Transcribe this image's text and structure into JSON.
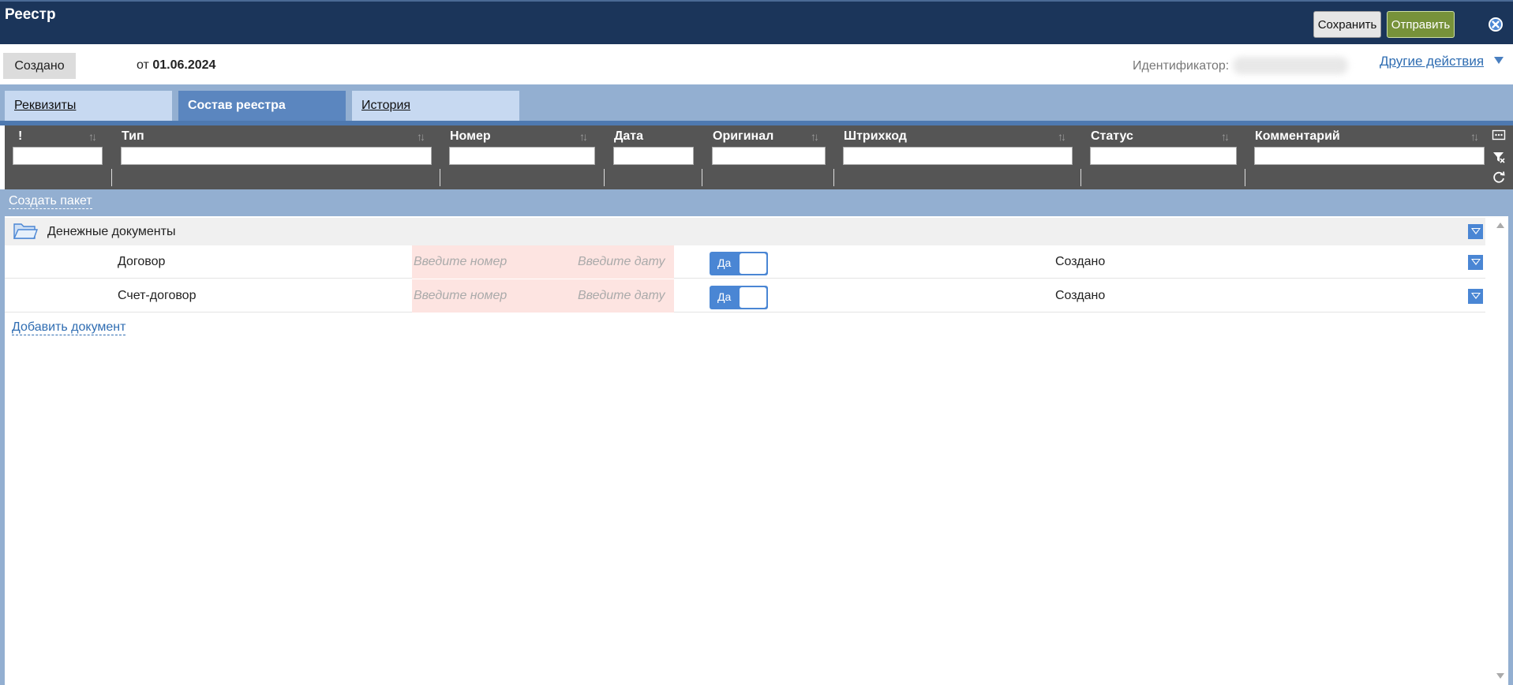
{
  "window": {
    "title": "Реестр",
    "save_label": "Сохранить",
    "send_label": "Отправить"
  },
  "status": {
    "badge": "Создано",
    "date_prefix": "от",
    "date": "01.06.2024",
    "identifier_label": "Идентификатор:",
    "other_actions": "Другие действия"
  },
  "tabs": [
    {
      "label": "Реквизиты",
      "active": false
    },
    {
      "label": "Состав реестра",
      "active": true
    },
    {
      "label": "История",
      "active": false
    }
  ],
  "columns": [
    {
      "label": "!"
    },
    {
      "label": "Тип"
    },
    {
      "label": "Номер"
    },
    {
      "label": "Дата"
    },
    {
      "label": "Оригинал"
    },
    {
      "label": "Штрихкод"
    },
    {
      "label": "Статус"
    },
    {
      "label": "Комментарий"
    }
  ],
  "actions": {
    "create_pack": "Создать пакет",
    "add_document": "Добавить документ"
  },
  "group": {
    "title": "Денежные документы"
  },
  "rows": [
    {
      "type": "Договор",
      "number_placeholder": "Введите номер",
      "date_placeholder": "Введите дату",
      "original": "Да",
      "status": "Создано"
    },
    {
      "type": "Счет-договор",
      "number_placeholder": "Введите номер",
      "date_placeholder": "Введите дату",
      "original": "Да",
      "status": "Создано"
    }
  ],
  "colors": {
    "header_bg": "#1b355a",
    "tab_active": "#5b86bf",
    "accent": "#4a86d4",
    "send_button": "#77923a",
    "invalid_cell": "#fde4e1"
  }
}
